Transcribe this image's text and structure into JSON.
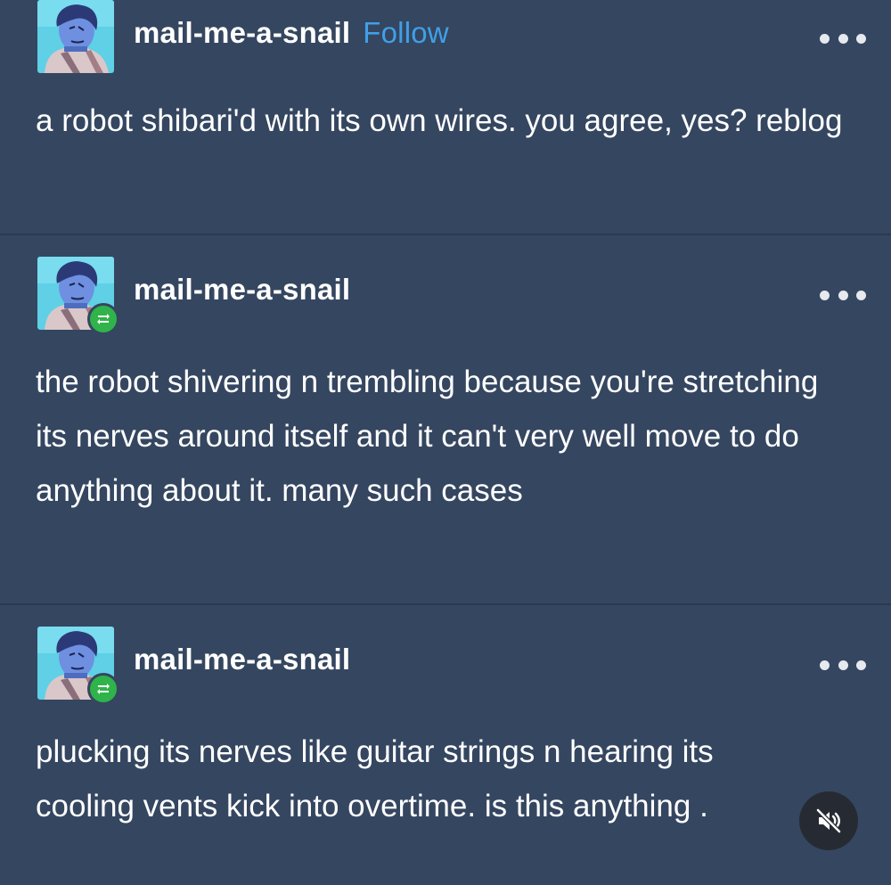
{
  "colors": {
    "background": "#354660",
    "text": "#ffffff",
    "follow_link": "#3fa0e8",
    "reblog_badge": "#2fb34a"
  },
  "posts": [
    {
      "username": "mail-me-a-snail",
      "follow_label": "Follow",
      "body": "a robot shibari'd with its own wires. you agree, yes? reblog",
      "reblog": false
    },
    {
      "username": "mail-me-a-snail",
      "body": "the robot shivering n trembling because you're stretching its nerves around itself and it can't very well move to do anything about it. many such cases",
      "reblog": true
    },
    {
      "username": "mail-me-a-snail",
      "body": "plucking its nerves like guitar strings n hearing its cooling vents kick into overtime. is this anything .",
      "reblog": true
    }
  ],
  "icons": {
    "more": "more-dots-icon",
    "reblog": "reblog-icon",
    "mute": "volume-muted-icon"
  }
}
